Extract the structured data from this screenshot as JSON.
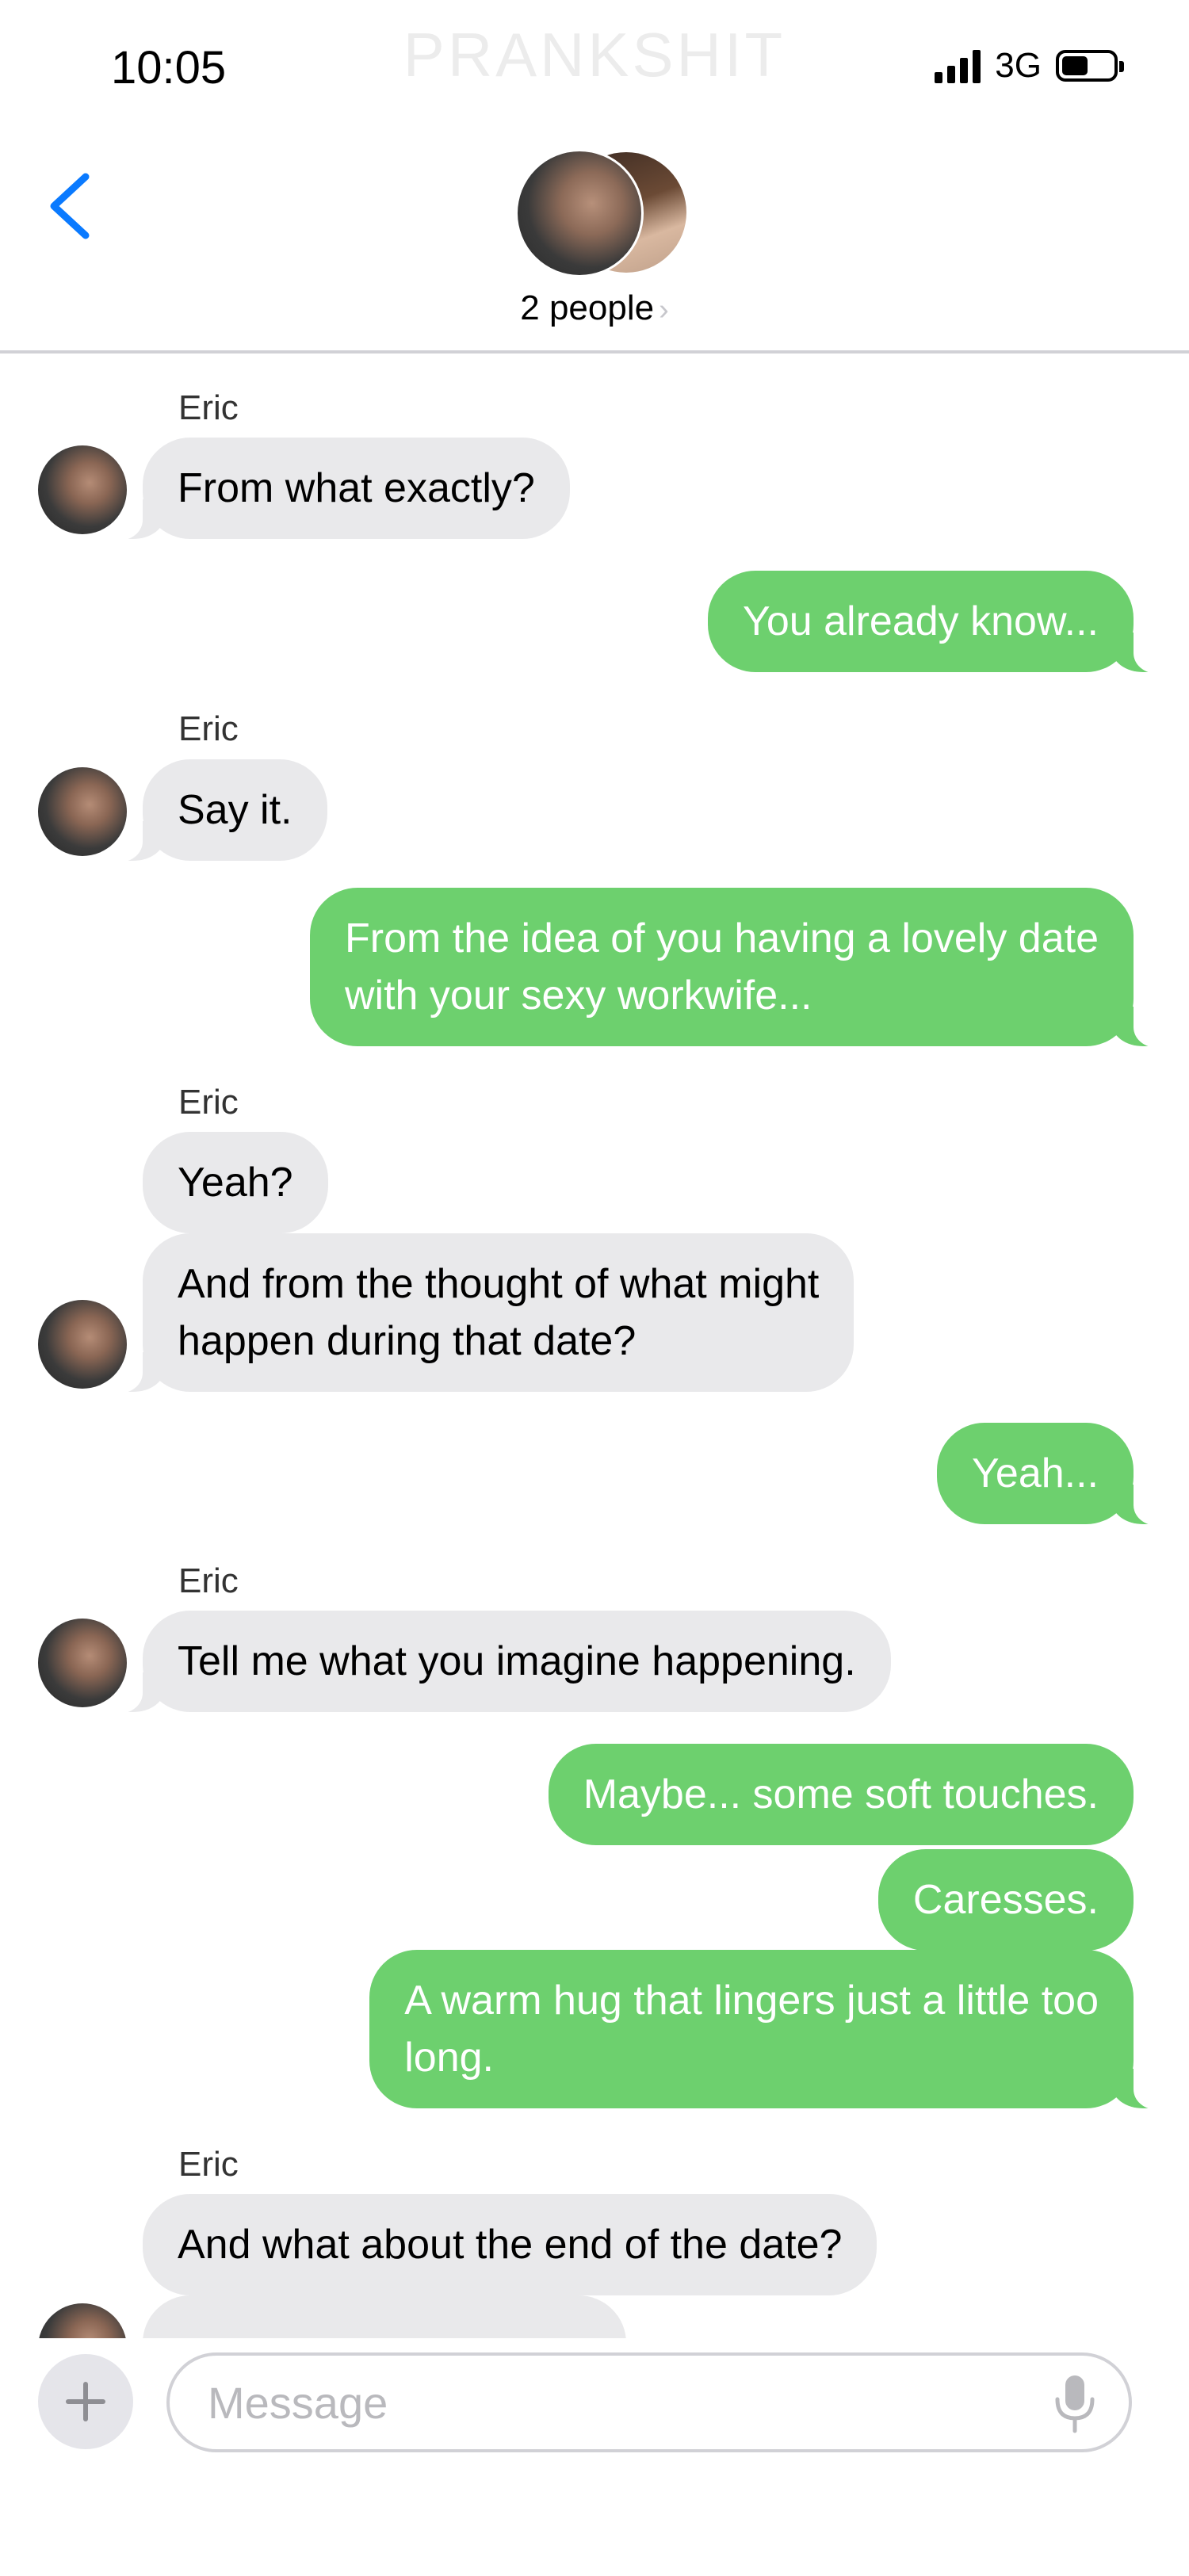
{
  "status_bar": {
    "time": "10:05",
    "network": "3G"
  },
  "watermark": "PRANKSHIT",
  "header": {
    "title": "2 people",
    "chevron": "›"
  },
  "messages": [
    {
      "sender": "Eric",
      "text": "From what exactly?",
      "direction": "incoming"
    },
    {
      "text": "You already know...",
      "direction": "outgoing"
    },
    {
      "sender": "Eric",
      "text": "Say it.",
      "direction": "incoming"
    },
    {
      "line1": "From the idea of you having a lovely date",
      "line2": "with your sexy workwife...",
      "direction": "outgoing"
    },
    {
      "sender": "Eric",
      "text": "Yeah?",
      "direction": "incoming"
    },
    {
      "line1": "And from the thought of what might",
      "line2": "happen during that date?",
      "direction": "incoming"
    },
    {
      "text": "Yeah...",
      "direction": "outgoing"
    },
    {
      "sender": "Eric",
      "text": "Tell me what you imagine happening.",
      "direction": "incoming"
    },
    {
      "text": "Maybe... some soft touches.",
      "direction": "outgoing"
    },
    {
      "text": "Caresses.",
      "direction": "outgoing"
    },
    {
      "line1": "A warm hug that lingers just a little too",
      "line2": "long.",
      "direction": "outgoing"
    },
    {
      "sender": "Eric",
      "text": "And what about the end of the date?",
      "direction": "incoming"
    }
  ],
  "composer": {
    "placeholder": "Message"
  },
  "colors": {
    "accent": "#0a7aff",
    "outgoing_bubble": "#6dd06e",
    "incoming_bubble": "#e9e9eb"
  }
}
